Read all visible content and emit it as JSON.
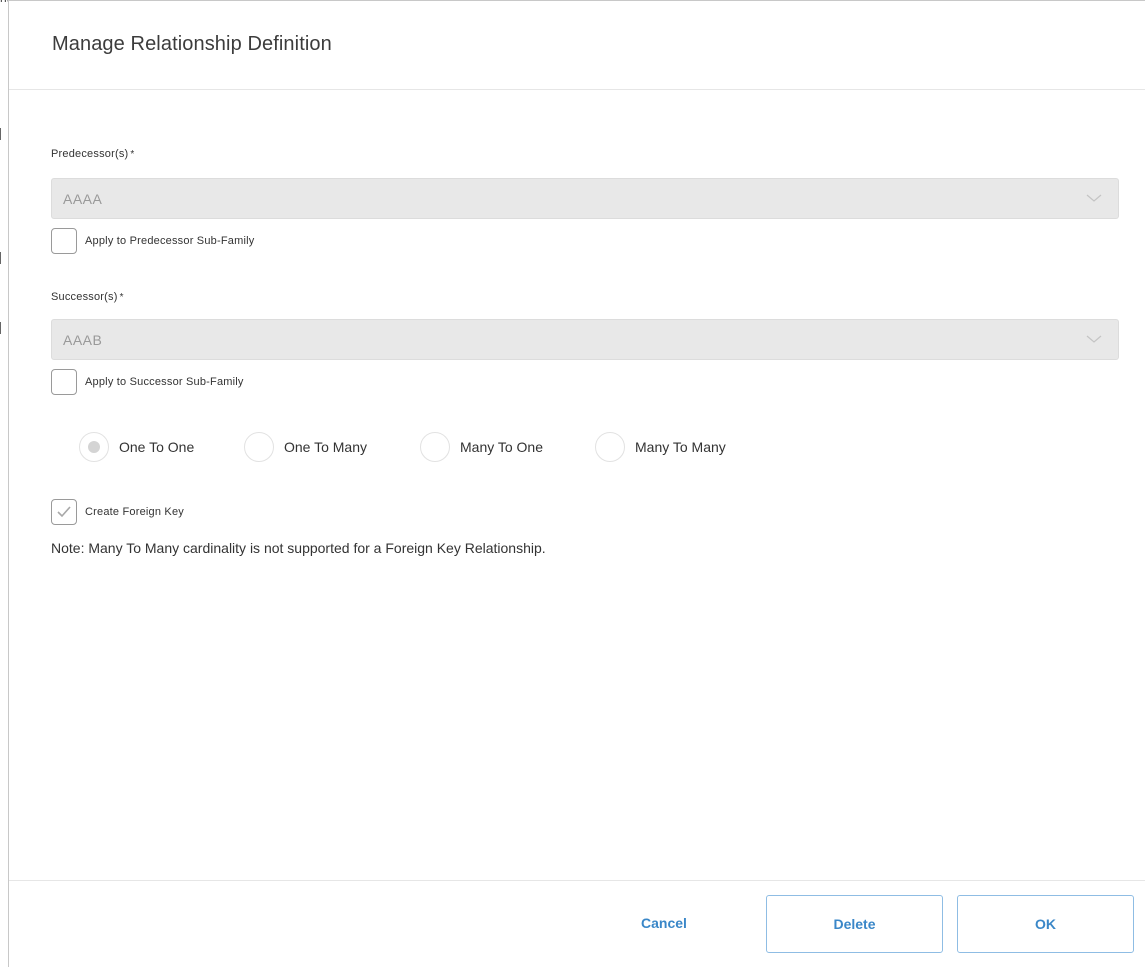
{
  "dialog": {
    "title": "Manage Relationship Definition"
  },
  "predecessor": {
    "label": "Predecessor(s)",
    "required_mark": "*",
    "value": "AAAA",
    "subfamily_checkbox_label": "Apply to Predecessor Sub-Family",
    "subfamily_checked": false
  },
  "successor": {
    "label": "Successor(s)",
    "required_mark": "*",
    "value": "AAAB",
    "subfamily_checkbox_label": "Apply to Successor Sub-Family",
    "subfamily_checked": false
  },
  "cardinality": {
    "options": [
      {
        "label": "One To One",
        "selected": true
      },
      {
        "label": "One To Many",
        "selected": false
      },
      {
        "label": "Many To One",
        "selected": false
      },
      {
        "label": "Many To Many",
        "selected": false
      }
    ]
  },
  "foreign_key": {
    "label": "Create Foreign Key",
    "checked": true
  },
  "note": "Note: Many To Many cardinality is not supported for a Foreign Key Relationship.",
  "footer": {
    "cancel_label": "Cancel",
    "delete_label": "Delete",
    "ok_label": "OK"
  },
  "colors": {
    "accent": "#3a87c8",
    "disabled_bg": "#e8e8e8",
    "disabled_text": "#999999"
  }
}
